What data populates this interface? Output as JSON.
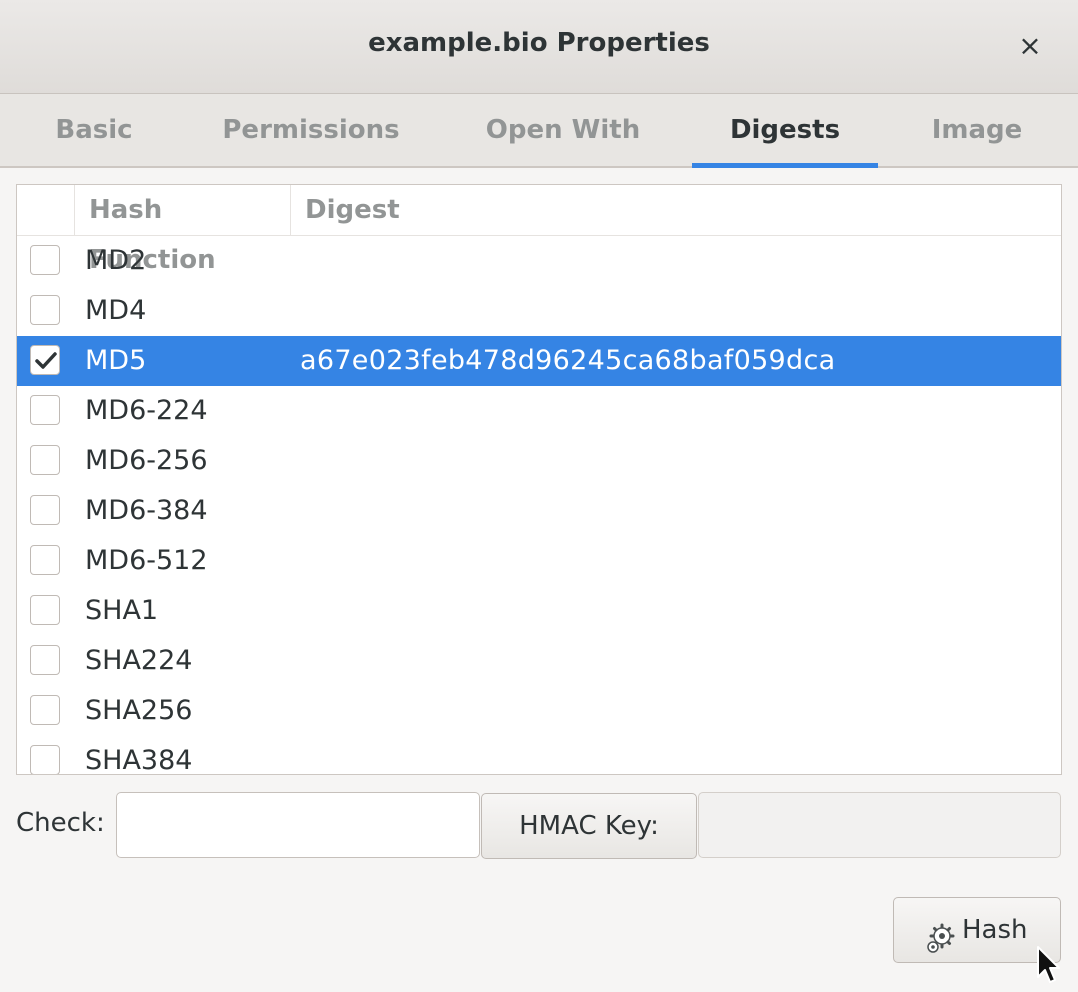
{
  "window": {
    "title": "example.bio Properties",
    "close_glyph": "×"
  },
  "tabs": [
    {
      "label": "Basic",
      "active": false
    },
    {
      "label": "Permissions",
      "active": false
    },
    {
      "label": "Open With",
      "active": false
    },
    {
      "label": "Digests",
      "active": true
    },
    {
      "label": "Image",
      "active": false
    }
  ],
  "table": {
    "columns": {
      "hash_function": "Hash Function",
      "digest": "Digest"
    },
    "rows": [
      {
        "name": "MD2",
        "checked": false,
        "digest": ""
      },
      {
        "name": "MD4",
        "checked": false,
        "digest": ""
      },
      {
        "name": "MD5",
        "checked": true,
        "digest": "a67e023feb478d96245ca68baf059dca",
        "selected": true
      },
      {
        "name": "MD6-224",
        "checked": false,
        "digest": ""
      },
      {
        "name": "MD6-256",
        "checked": false,
        "digest": ""
      },
      {
        "name": "MD6-384",
        "checked": false,
        "digest": ""
      },
      {
        "name": "MD6-512",
        "checked": false,
        "digest": ""
      },
      {
        "name": "SHA1",
        "checked": false,
        "digest": ""
      },
      {
        "name": "SHA224",
        "checked": false,
        "digest": ""
      },
      {
        "name": "SHA256",
        "checked": false,
        "digest": ""
      },
      {
        "name": "SHA384",
        "checked": false,
        "digest": ""
      }
    ]
  },
  "check": {
    "label": "Check:",
    "value": ""
  },
  "hmac": {
    "button_label": "HMAC Key:",
    "value": ""
  },
  "hash_button": {
    "label": "Hash",
    "icon": "gear-icon"
  },
  "colors": {
    "accent": "#3584e4",
    "background": "#f6f5f4"
  }
}
